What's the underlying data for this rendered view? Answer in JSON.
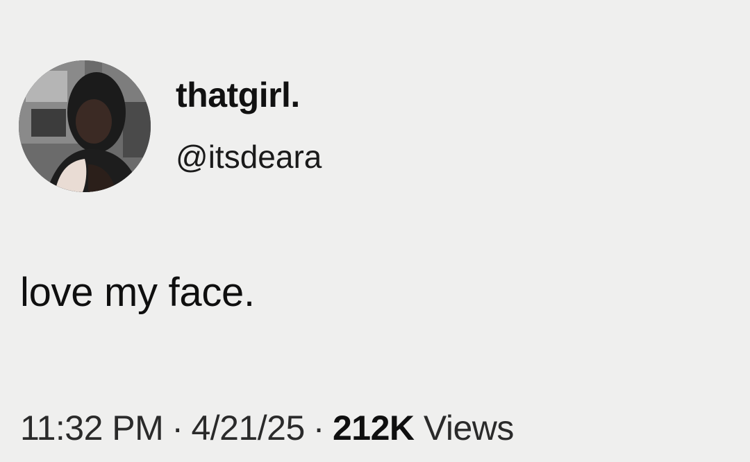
{
  "tweet": {
    "display_name": "thatgirl.",
    "handle": "@itsdeara",
    "text": "love my face.",
    "time": "11:32 PM",
    "date": "4/21/25",
    "views_count": "212K",
    "views_label": "Views",
    "separator": "·"
  },
  "avatar": {
    "icon": "profile-photo"
  }
}
